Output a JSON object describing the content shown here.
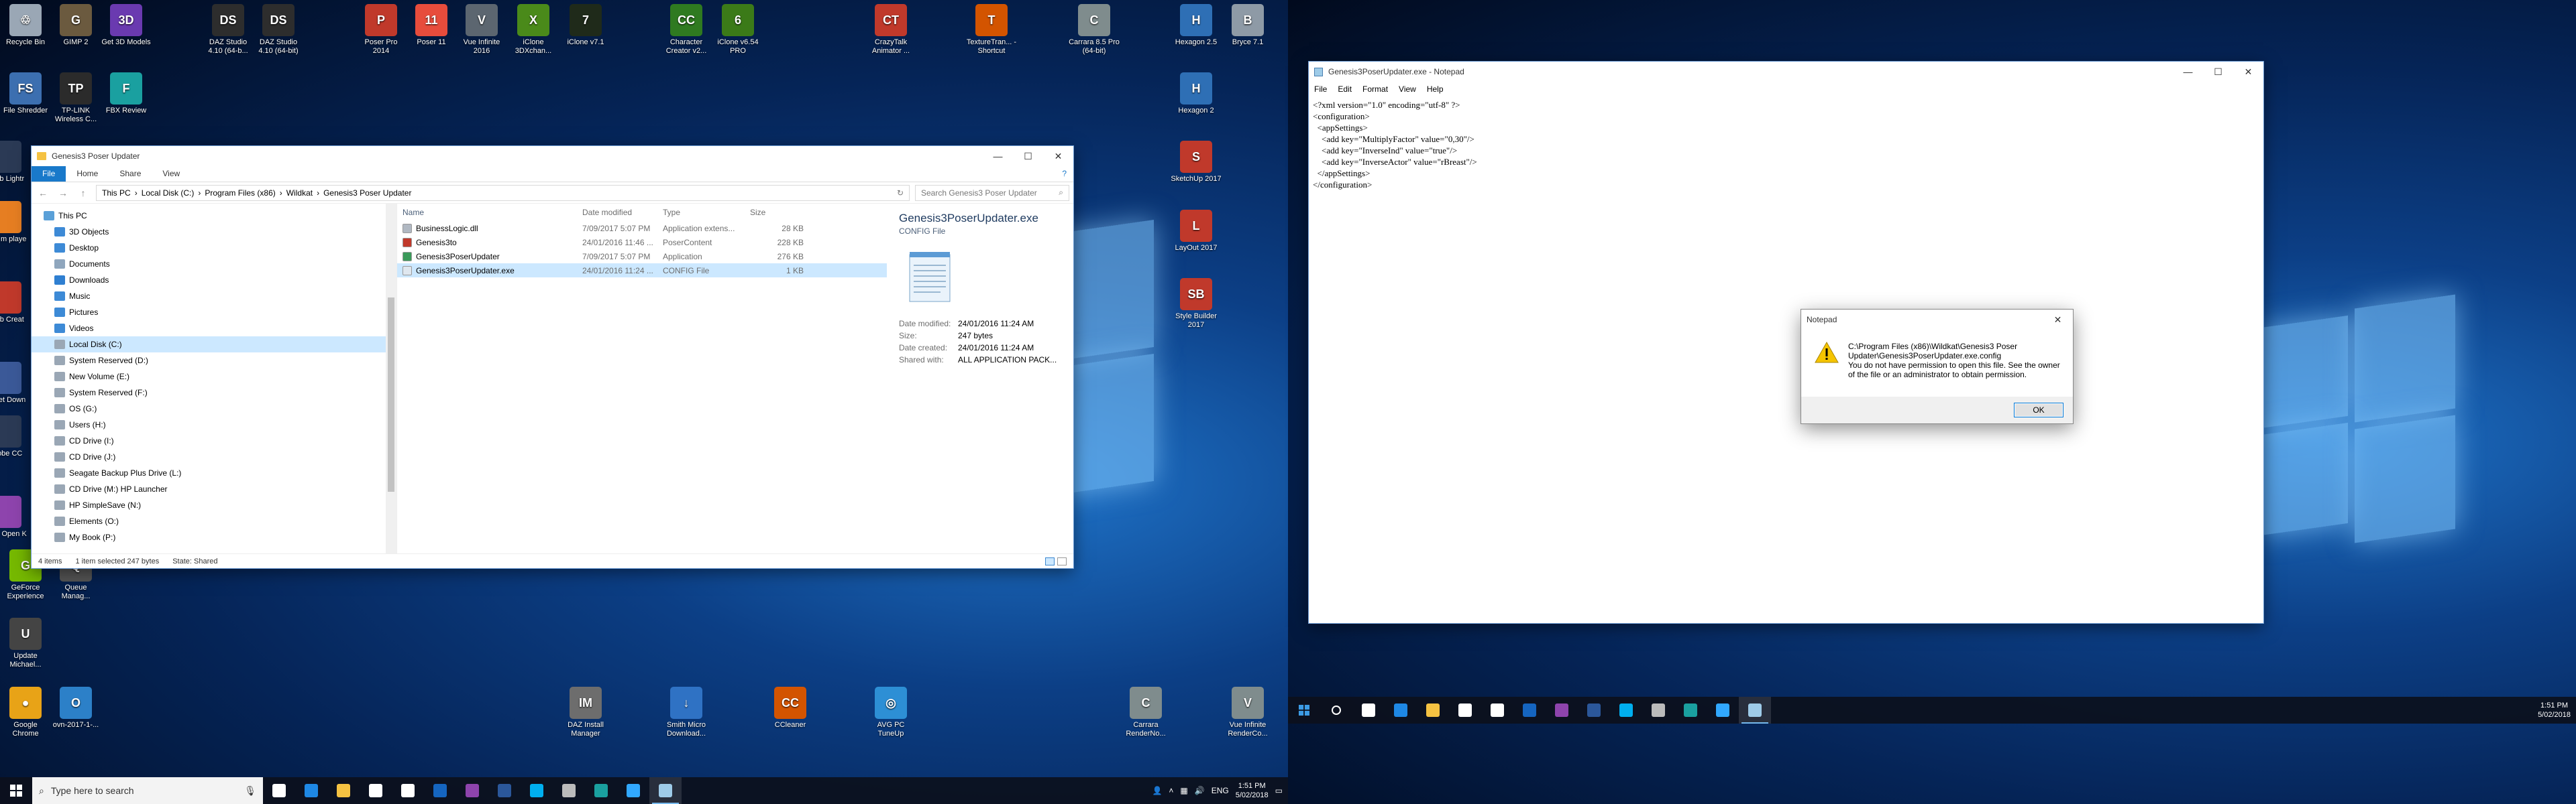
{
  "desktop_left": {
    "icons": [
      {
        "label": "Recycle Bin",
        "color": "#9aa7b5",
        "glyph": "♲"
      },
      {
        "label": "GIMP 2",
        "color": "#6b5a3f",
        "glyph": "G"
      },
      {
        "label": "Get 3D Models",
        "color": "#6a3ab0",
        "glyph": "3D"
      },
      {
        "label": "DAZ Studio 4.10 (64-b...",
        "color": "#2d2d2d",
        "glyph": "DS"
      },
      {
        "label": "DAZ Studio 4.10 (64-bit)",
        "color": "#2d2d2d",
        "glyph": "DS"
      },
      {
        "label": "Poser Pro 2014",
        "color": "#c0392b",
        "glyph": "P"
      },
      {
        "label": "Poser 11",
        "color": "#e74c3c",
        "glyph": "11"
      },
      {
        "label": "Vue Infinite 2016",
        "color": "#5c6670",
        "glyph": "V"
      },
      {
        "label": "iClone 3DXchan...",
        "color": "#4a8a1a",
        "glyph": "X"
      },
      {
        "label": "iClone v7.1",
        "color": "#1f2a1a",
        "glyph": "7"
      },
      {
        "label": "Character Creator v2...",
        "color": "#2f7a20",
        "glyph": "CC"
      },
      {
        "label": "iClone v6.54 PRO",
        "color": "#3b7a18",
        "glyph": "6"
      },
      {
        "label": "CrazyTalk Animator ...",
        "color": "#c0392b",
        "glyph": "CT"
      },
      {
        "label": "TextureTran... - Shortcut",
        "color": "#d35400",
        "glyph": "T"
      },
      {
        "label": "Carrara 8.5 Pro (64-bit)",
        "color": "#7f8c8d",
        "glyph": "C"
      },
      {
        "label": "Hexagon 2.5",
        "color": "#2e6fb5",
        "glyph": "H"
      },
      {
        "label": "Bryce 7.1",
        "color": "#8e9aa6",
        "glyph": "B"
      },
      {
        "label": "File Shredder",
        "color": "#3c6fb0",
        "glyph": "FS"
      },
      {
        "label": "TP-LINK Wireless C...",
        "color": "#2b2b2b",
        "glyph": "TP"
      },
      {
        "label": "FBX Review",
        "color": "#1aa0a0",
        "glyph": "F"
      },
      {
        "label": "Hexagon 2",
        "color": "#2e6fb5",
        "glyph": "H"
      },
      {
        "label": "SketchUp 2017",
        "color": "#c0392b",
        "glyph": "S"
      },
      {
        "label": "LayOut 2017",
        "color": "#c0392b",
        "glyph": "L"
      },
      {
        "label": "Style Builder 2017",
        "color": "#c0392b",
        "glyph": "SB"
      },
      {
        "label": "GeForce Experience",
        "color": "#76b900",
        "glyph": "G"
      },
      {
        "label": "Queue Manag...",
        "color": "#555555",
        "glyph": "Q"
      },
      {
        "label": "Update Michael...",
        "color": "#444444",
        "glyph": "U"
      },
      {
        "label": "Google Chrome",
        "color": "#e8a317",
        "glyph": "●"
      },
      {
        "label": "ovn-2017-1-...",
        "color": "#2c80c8",
        "glyph": "O"
      },
      {
        "label": "DAZ Install Manager",
        "color": "#6d6d6d",
        "glyph": "IM"
      },
      {
        "label": "Smith Micro Download...",
        "color": "#2f72c4",
        "glyph": "↓"
      },
      {
        "label": "CCleaner",
        "color": "#d35400",
        "glyph": "CC"
      },
      {
        "label": "AVG PC TuneUp",
        "color": "#2d8fd5",
        "glyph": "◎"
      },
      {
        "label": "Carrara RenderNo...",
        "color": "#7f8c8d",
        "glyph": "C"
      },
      {
        "label": "Vue Infinite RenderCo...",
        "color": "#7f8c8d",
        "glyph": "V"
      }
    ],
    "partial_icons": [
      {
        "label": "Adob Lightr",
        "color": "#2b3a55"
      },
      {
        "label": "VLC m playe",
        "color": "#e67e22"
      },
      {
        "label": "Adob Creat",
        "color": "#c0392b"
      },
      {
        "label": "Street Down",
        "color": "#3b5998"
      },
      {
        "label": "Adobe CC",
        "color": "#2b3a55"
      },
      {
        "label": "RAR Open K",
        "color": "#8e44ad"
      }
    ]
  },
  "explorer": {
    "title": "Genesis3 Poser Updater",
    "ribbon_tabs": [
      "File",
      "Home",
      "Share",
      "View"
    ],
    "breadcrumb": [
      "This PC",
      "Local Disk (C:)",
      "Program Files (x86)",
      "Wildkat",
      "Genesis3 Poser Updater"
    ],
    "search_placeholder": "Search Genesis3 Poser Updater",
    "nav_items": [
      {
        "label": "This PC",
        "color": "#5aa0d8",
        "indent": 0
      },
      {
        "label": "3D Objects",
        "color": "#3d8ad6",
        "indent": 1
      },
      {
        "label": "Desktop",
        "color": "#3d8ad6",
        "indent": 1
      },
      {
        "label": "Documents",
        "color": "#8fa6bd",
        "indent": 1
      },
      {
        "label": "Downloads",
        "color": "#2f7fd1",
        "indent": 1
      },
      {
        "label": "Music",
        "color": "#3d8ad6",
        "indent": 1
      },
      {
        "label": "Pictures",
        "color": "#3d8ad6",
        "indent": 1
      },
      {
        "label": "Videos",
        "color": "#3d8ad6",
        "indent": 1
      },
      {
        "label": "Local Disk (C:)",
        "color": "#9aa7b5",
        "indent": 1,
        "selected": true
      },
      {
        "label": "System Reserved (D:)",
        "color": "#9aa7b5",
        "indent": 1
      },
      {
        "label": "New Volume (E:)",
        "color": "#9aa7b5",
        "indent": 1
      },
      {
        "label": "System Reserved (F:)",
        "color": "#9aa7b5",
        "indent": 1
      },
      {
        "label": "OS (G:)",
        "color": "#9aa7b5",
        "indent": 1
      },
      {
        "label": "Users (H:)",
        "color": "#9aa7b5",
        "indent": 1
      },
      {
        "label": "CD Drive (I:)",
        "color": "#9aa7b5",
        "indent": 1
      },
      {
        "label": "CD Drive (J:)",
        "color": "#9aa7b5",
        "indent": 1
      },
      {
        "label": "Seagate Backup Plus Drive (L:)",
        "color": "#9aa7b5",
        "indent": 1
      },
      {
        "label": "CD Drive (M:) HP Launcher",
        "color": "#9aa7b5",
        "indent": 1
      },
      {
        "label": "HP SimpleSave (N:)",
        "color": "#9aa7b5",
        "indent": 1
      },
      {
        "label": "Elements (O:)",
        "color": "#9aa7b5",
        "indent": 1
      },
      {
        "label": "My Book (P:)",
        "color": "#9aa7b5",
        "indent": 1
      }
    ],
    "columns": [
      "Name",
      "Date modified",
      "Type",
      "Size"
    ],
    "files": [
      {
        "name": "BusinessLogic.dll",
        "date": "7/09/2017 5:07 PM",
        "type": "Application extens...",
        "size": "28 KB",
        "color": "#b0b8c2"
      },
      {
        "name": "Genesis3to",
        "date": "24/01/2016 11:46 ...",
        "type": "PoserContent",
        "size": "228 KB",
        "color": "#c0392b"
      },
      {
        "name": "Genesis3PoserUpdater",
        "date": "7/09/2017 5:07 PM",
        "type": "Application",
        "size": "276 KB",
        "color": "#3b9a5a"
      },
      {
        "name": "Genesis3PoserUpdater.exe",
        "date": "24/01/2016 11:24 ...",
        "type": "CONFIG File",
        "size": "1 KB",
        "color": "#dfe7ef",
        "selected": true
      }
    ],
    "preview": {
      "name": "Genesis3PoserUpdater.exe",
      "type": "CONFIG File",
      "props": [
        {
          "k": "Date modified:",
          "v": "24/01/2016 11:24 AM"
        },
        {
          "k": "Size:",
          "v": "247 bytes"
        },
        {
          "k": "Date created:",
          "v": "24/01/2016 11:24 AM"
        },
        {
          "k": "Shared with:",
          "v": "ALL APPLICATION PACK..."
        }
      ]
    },
    "status": {
      "items": "4 items",
      "selected": "1 item selected  247 bytes",
      "state": "State:  Shared"
    }
  },
  "notepad": {
    "title": "Genesis3PoserUpdater.exe - Notepad",
    "menu": [
      "File",
      "Edit",
      "Format",
      "View",
      "Help"
    ],
    "lines": [
      "<?xml version=\"1.0\" encoding=\"utf-8\" ?>",
      "<configuration>",
      "  <appSettings>",
      "    <add key=\"MultiplyFactor\" value=\"0,30\"/>",
      "    <add key=\"InverseInd\" value=\"true\"/>",
      "    <add key=\"InverseActor\" value=\"rBreast\"/>",
      "  </appSettings>",
      "</configuration>"
    ]
  },
  "dialog": {
    "title": "Notepad",
    "message_lines": [
      "C:\\Program Files (x86)\\Wildkat\\Genesis3 Poser",
      "Updater\\Genesis3PoserUpdater.exe.config",
      "You do not have permission to open this file.  See the owner",
      "of the file or an administrator to obtain permission."
    ],
    "ok_label": "OK"
  },
  "taskbar_left": {
    "search_placeholder": "Type here to search",
    "pinned": [
      {
        "name": "task-view-icon",
        "color": "#ffffff"
      },
      {
        "name": "edge-icon",
        "color": "#1e88e5"
      },
      {
        "name": "explorer-icon",
        "color": "#f5c242"
      },
      {
        "name": "store-icon",
        "color": "#ffffff"
      },
      {
        "name": "mail-icon",
        "color": "#ffffff"
      },
      {
        "name": "outlook-icon",
        "color": "#1565c0"
      },
      {
        "name": "app-purple-icon",
        "color": "#8e44ad"
      },
      {
        "name": "word-icon",
        "color": "#2b579a"
      },
      {
        "name": "skype-icon",
        "color": "#00aff0"
      },
      {
        "name": "tools-icon",
        "color": "#bbbbbb"
      },
      {
        "name": "fbx-icon",
        "color": "#1aa0a0"
      },
      {
        "name": "photoshop-icon",
        "color": "#31a8ff"
      },
      {
        "name": "notepad-icon",
        "color": "#9ecbe8"
      }
    ],
    "tray": {
      "lang": "ENG",
      "time": "1:51 PM",
      "date": "5/02/2018"
    }
  },
  "taskbar_right": {
    "tray": {
      "time": "1:51 PM",
      "date": "5/02/2018"
    }
  }
}
